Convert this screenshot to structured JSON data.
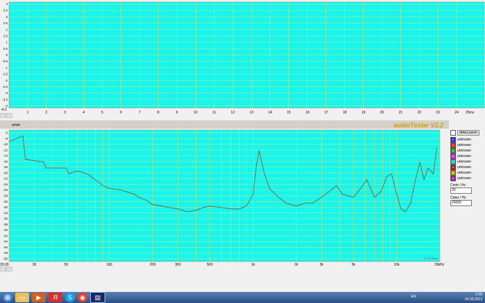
{
  "upper_chart": {
    "y_ticks": [
      "4",
      "3.5",
      "3",
      "2.5",
      "2",
      "1.5",
      "1",
      "0.5",
      "0",
      "-0.5",
      "-1",
      "-1.5",
      "-2",
      "-2.5",
      "-3",
      "-3.5",
      "-4"
    ],
    "x_ticks": [
      "1",
      "2",
      "3",
      "4",
      "5",
      "6",
      "7",
      "8",
      "9",
      "10",
      "11",
      "12",
      "13",
      "14",
      "15",
      "16",
      "17",
      "18",
      "19",
      "20",
      "21",
      "22",
      "23",
      "24"
    ],
    "x_unit": "25ms",
    "y_bottom_label": "-4.2"
  },
  "label_strip": {
    "text": "ainak",
    "app_title": "audioTester V2.2"
  },
  "lower_chart": {
    "y_ticks": [
      "-5",
      "-8",
      "-10",
      "-12",
      "-14",
      "-16",
      "-18",
      "-20",
      "-22",
      "-24",
      "-26",
      "-28",
      "-30",
      "-32",
      "-34",
      "-36",
      "-38",
      "-40",
      "-42",
      "-44",
      "-46",
      "-48",
      "-50"
    ],
    "x_ticks": [
      "30",
      "50",
      "100",
      "200",
      "300",
      "500",
      "1k",
      "2k",
      "3k",
      "5k",
      "10k"
    ],
    "x_start": "20.00",
    "x_end": "20kHz",
    "watermark": "© CS Helm"
  },
  "chart_data": {
    "type": "line",
    "title": "",
    "xlabel": "",
    "ylabel": "",
    "x_scale": "log",
    "xlim": [
      20,
      20000
    ],
    "ylim": [
      -50,
      -5
    ],
    "x": [
      20,
      25,
      26,
      35,
      36,
      50,
      52,
      60,
      70,
      80,
      90,
      100,
      120,
      150,
      160,
      180,
      200,
      230,
      260,
      300,
      350,
      400,
      450,
      500,
      600,
      700,
      800,
      900,
      1000,
      1050,
      1100,
      1200,
      1300,
      1500,
      1700,
      2000,
      2300,
      2600,
      3000,
      3400,
      3800,
      4200,
      5000,
      5600,
      6200,
      7000,
      7800,
      8500,
      9200,
      10000,
      10700,
      11500,
      12500,
      13500,
      14500,
      15500,
      16500,
      18000,
      19000
    ],
    "series": [
      {
        "values": [
          -9,
          -7,
          -15,
          -16,
          -18,
          -18,
          -20,
          -19,
          -20,
          -22,
          -24,
          -25,
          -25.5,
          -27,
          -28,
          -29,
          -30.5,
          -31,
          -31.5,
          -32,
          -33,
          -32.5,
          -31.5,
          -31,
          -31.5,
          -32,
          -32,
          -31,
          -27,
          -18,
          -12,
          -20,
          -25,
          -28,
          -30,
          -31,
          -30,
          -30,
          -28,
          -26,
          -24,
          -27,
          -28,
          -25,
          -22,
          -28,
          -26,
          -21,
          -20,
          -27,
          -32,
          -33,
          -30,
          -22,
          -16,
          -22,
          -18,
          -20,
          -11
        ]
      }
    ]
  },
  "legend": {
    "header": "dökel.yarım",
    "items": [
      {
        "letter": "A",
        "label": "unknown",
        "color": "#2a2aff"
      },
      {
        "letter": "A",
        "label": "unknown",
        "color": "#e02020"
      },
      {
        "letter": "A",
        "label": "unknown",
        "color": "#20a020"
      },
      {
        "letter": "A",
        "label": "unknown",
        "color": "#e020e0"
      },
      {
        "letter": "A",
        "label": "unknown",
        "color": "#20c0c0"
      },
      {
        "letter": "A",
        "label": "unknown",
        "color": "#a02020"
      },
      {
        "letter": "A",
        "label": "unknown",
        "color": "#c0a000"
      },
      {
        "letter": "A",
        "label": "unknown",
        "color": "#a020a0"
      }
    ],
    "field1_label": "Сmin / Hz",
    "field1_value": "20",
    "field2_label": "Смах / Hz",
    "field2_value": "20000"
  },
  "taskbar": {
    "lang": "EN",
    "time": "5:28",
    "date": "04.09.2013"
  },
  "colors": {
    "plot_bg": "#19f5ec",
    "grid": "#d8e870",
    "trace": "#7a4a2a",
    "axis_text": "#000000"
  }
}
